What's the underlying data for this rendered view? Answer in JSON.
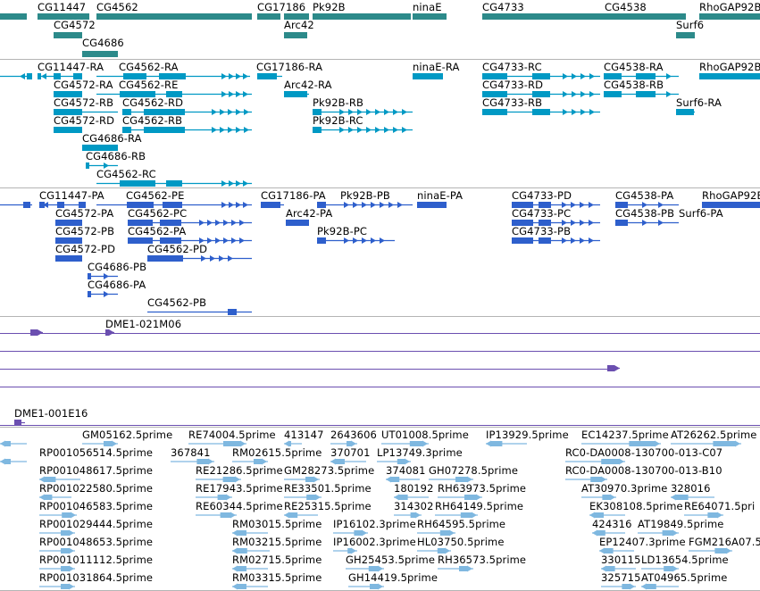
{
  "colors": {
    "gene": "#2c8a8a",
    "transcript": "#0099c4",
    "protein": "#2e5fcc",
    "clone": "#6b4fb0",
    "est": "#7fb8e0",
    "separator": "#b4b4b4"
  },
  "tracks": {
    "genes": {
      "labels": [
        "CG11447",
        "CG4562",
        "CG17186",
        "Pk92B",
        "ninaE",
        "CG4733",
        "CG4538",
        "RhoGAP92B",
        "CG4572",
        "Arc42",
        "Surf6",
        "CG4686"
      ]
    },
    "transcripts": {
      "labels": [
        "CG11447-RA",
        "CG4562-RA",
        "CG17186-RA",
        "ninaE-RA",
        "CG4733-RC",
        "CG4538-RA",
        "RhoGAP92B",
        "CG4572-RA",
        "CG4562-RE",
        "Arc42-RA",
        "CG4733-RD",
        "CG4538-RB",
        "CG4572-RB",
        "CG4562-RD",
        "Pk92B-RB",
        "CG4733-RB",
        "Surf6-RA",
        "CG4572-RD",
        "CG4562-RB",
        "Pk92B-RC",
        "CG4686-RA",
        "CG4686-RB",
        "CG4562-RC"
      ]
    },
    "proteins": {
      "labels": [
        "CG11447-PA",
        "CG4562-PE",
        "CG17186-PA",
        "Pk92B-PB",
        "ninaE-PA",
        "CG4733-PD",
        "CG4538-PA",
        "RhoGAP92B",
        "CG4572-PA",
        "CG4562-PC",
        "Arc42-PA",
        "CG4733-PC",
        "CG4538-PB",
        "Surf6-PA",
        "CG4572-PB",
        "CG4562-PA",
        "Pk92B-PC",
        "CG4733-PB",
        "CG4572-PD",
        "CG4562-PD",
        "CG4686-PB",
        "CG4686-PA",
        "CG4562-PB"
      ]
    },
    "clones": {
      "labels": [
        "DME1-021M06",
        "DME1-001E16"
      ]
    },
    "ests": {
      "labels": [
        "GM05162.5prime",
        "RE74004.5prime",
        "413147",
        "2643606",
        "UT01008.5prime",
        "IP13929.5prime",
        "EC14237.5prime",
        "AT26262.5prime",
        "RP001056514.5prime",
        "367841",
        "RM02615.5prime",
        "370701",
        "LP13749.3prime",
        "RC0-DA0008-130700-013-C07",
        "RP001048617.5prime",
        "RE21286.5prime",
        "GM28273.5prime",
        "374081",
        "GH07278.5prime",
        "RC0-DA0008-130700-013-B10",
        "RP001022580.5prime",
        "RE17943.5prime",
        "RE33501.5prime",
        "180192",
        "RH63973.5prime",
        "AT30970.3prime",
        "328016",
        "RP001046583.5prime",
        "RE60344.5prime",
        "RE25315.5prime",
        "314302",
        "RH64149.5prime",
        "EK308108.5prime",
        "RE64071.5pri",
        "RP001029444.5prime",
        "RM03015.5prime",
        "IP16102.3prime",
        "RH64595.5prime",
        "424316",
        "AT19849.5prime",
        "RP001048653.5prime",
        "RM03215.5prime",
        "IP16002.3prime",
        "HL03750.5prime",
        "EP12407.3prime",
        "FGM216A07.5",
        "RP001011112.5prime",
        "RM02715.5prime",
        "GH25453.5prime",
        "RH36573.5prime",
        "330115",
        "LD13654.5prime",
        "RP001031864.5prime",
        "RM03315.5prime",
        "GH14419.5prime",
        "325715",
        "AT04965.5prime"
      ]
    }
  }
}
